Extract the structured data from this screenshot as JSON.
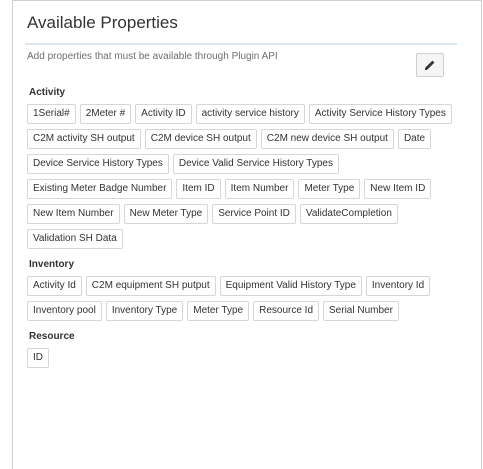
{
  "panel": {
    "title": "Available Properties",
    "subtitle": "Add properties that must be available through Plugin API",
    "edit_icon": "pencil-icon"
  },
  "sections": [
    {
      "title": "Activity",
      "items": [
        "1Serial#",
        "2Meter #",
        "Activity ID",
        "activity service history",
        "Activity Service History Types",
        "C2M activity SH output",
        "C2M device SH output",
        "C2M new device SH output",
        "Date",
        "Device Service History Types",
        "Device Valid Service History Types",
        "Existing Meter Badge Number",
        "Item ID",
        "Item Number",
        "Meter Type",
        "New Item ID",
        "New Item Number",
        "New Meter Type",
        "Service Point ID",
        "ValidateCompletion",
        "Validation SH Data"
      ]
    },
    {
      "title": "Inventory",
      "items": [
        "Activity Id",
        "C2M equipment SH putput",
        "Equipment Valid History Type",
        "Inventory Id",
        "Inventory pool",
        "Inventory Type",
        "Meter Type",
        "Resource Id",
        "Serial Number"
      ]
    },
    {
      "title": "Resource",
      "items": [
        "ID"
      ]
    }
  ]
}
